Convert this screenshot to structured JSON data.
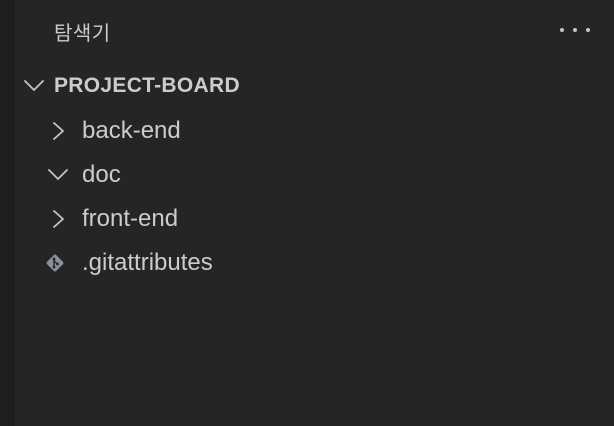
{
  "explorer": {
    "title": "탐색기",
    "more_actions_icon": "ellipsis-icon"
  },
  "project": {
    "name": "PROJECT-BOARD",
    "expanded": true,
    "items": [
      {
        "label": "back-end",
        "type": "folder",
        "expanded": false,
        "icon": "chevron-right-icon"
      },
      {
        "label": "doc",
        "type": "folder",
        "expanded": true,
        "icon": "chevron-down-icon"
      },
      {
        "label": "front-end",
        "type": "folder",
        "expanded": false,
        "icon": "chevron-right-icon"
      },
      {
        "label": ".gitattributes",
        "type": "file",
        "icon": "git-file-icon"
      }
    ]
  },
  "colors": {
    "background": "#252526",
    "activity_bar": "#1e1e1e",
    "text": "#cccccc",
    "icon": "#c5c5c5",
    "git_icon": "#8a8f9b"
  }
}
